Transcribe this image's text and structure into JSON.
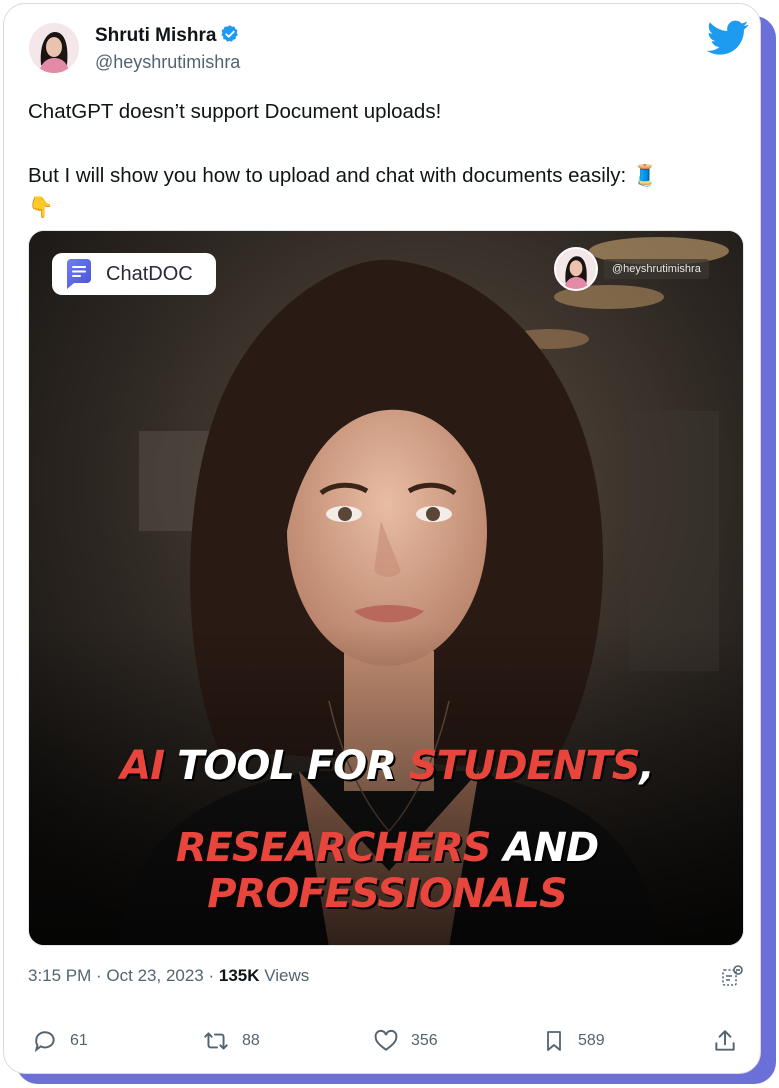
{
  "tweet": {
    "author_name": "Shruti Mishra",
    "handle": "@heyshrutimishra",
    "text_line1": "ChatGPT doesn’t support Document uploads!",
    "text_line2": "But I will show you how to upload and chat with documents easily:",
    "emoji_thread": "🧵",
    "emoji_point": "👇",
    "time": "3:15 PM",
    "date": "Oct 23, 2023",
    "views_count": "135K",
    "views_label": "Views"
  },
  "media": {
    "badge_label": "ChatDOC",
    "watermark_handle": "@heyshrutimishra",
    "headline": {
      "w1": "AI",
      "w2": "TOOL FOR",
      "w3": "STUDENTS",
      "w4": ",",
      "w5": "RESEARCHERS",
      "w6": "AND",
      "w7": "PROFESSIONALS"
    }
  },
  "actions": {
    "replies": "61",
    "retweets": "88",
    "likes": "356",
    "bookmarks": "589"
  },
  "icons": {
    "verified": "verified-badge-icon",
    "brand": "twitter-bird-icon",
    "reply": "reply-icon",
    "retweet": "retweet-icon",
    "like": "heart-icon",
    "bookmark": "bookmark-icon",
    "share": "share-icon",
    "analytics": "analytics-icon"
  },
  "colors": {
    "twitter_blue": "#1d9bf0",
    "accent_frame": "#6b6fd8",
    "headline_red": "#e8453c"
  }
}
